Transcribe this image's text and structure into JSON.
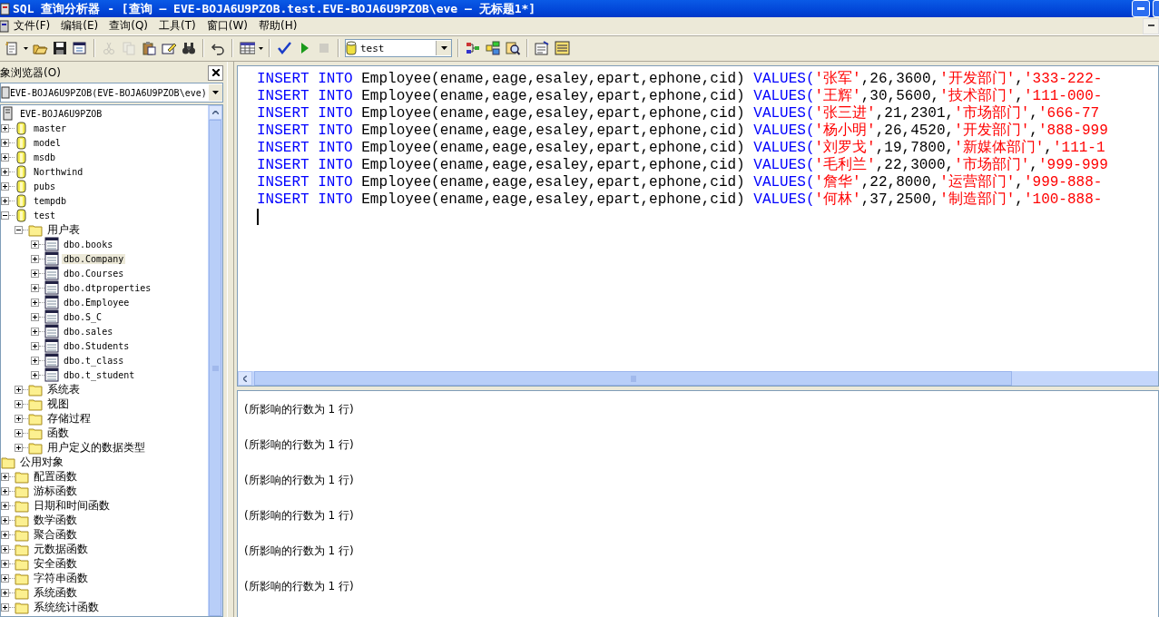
{
  "window": {
    "title": "SQL 查询分析器 - [查询 — EVE-BOJA6U9PZOB.test.EVE-BOJA6U9PZOB\\eve — 无标题1*]"
  },
  "menu": [
    "文件(F)",
    "编辑(E)",
    "查询(Q)",
    "工具(T)",
    "窗口(W)",
    "帮助(H)"
  ],
  "toolbar": [
    {
      "kind": "button",
      "disabled": false
    },
    {
      "kind": "caret"
    },
    {
      "kind": "button",
      "disabled": false
    },
    {
      "kind": "button",
      "disabled": false
    },
    {
      "kind": "button",
      "disabled": false
    },
    {
      "kind": "separator"
    },
    {
      "kind": "button",
      "disabled": true
    },
    {
      "kind": "button",
      "disabled": true
    },
    {
      "kind": "button",
      "disabled": false
    },
    {
      "kind": "button",
      "disabled": false
    },
    {
      "kind": "button",
      "disabled": false
    },
    {
      "kind": "separator"
    },
    {
      "kind": "button",
      "disabled": false
    },
    {
      "kind": "separator"
    },
    {
      "kind": "button",
      "disabled": false
    },
    {
      "kind": "caret"
    },
    {
      "kind": "separator"
    },
    {
      "kind": "button",
      "disabled": false
    },
    {
      "kind": "button",
      "disabled": false
    },
    {
      "kind": "button",
      "disabled": true
    },
    {
      "kind": "separator"
    },
    {
      "kind": "database_select",
      "value": "test"
    },
    {
      "kind": "separator"
    },
    {
      "kind": "button",
      "disabled": false
    },
    {
      "kind": "button",
      "disabled": false
    },
    {
      "kind": "button",
      "disabled": false
    },
    {
      "kind": "separator"
    },
    {
      "kind": "button",
      "disabled": false
    },
    {
      "kind": "button",
      "disabled": false
    }
  ],
  "object_browser": {
    "title": "象浏览器(O)",
    "server_select": "EVE-BOJA6U9PZOB(EVE-BOJA6U9PZOB\\eve)",
    "tree": [
      {
        "label": "EVE-BOJA6U9PZOB",
        "kind": "server",
        "selected": false,
        "children": [
          {
            "label": "master",
            "kind": "database",
            "expanded": false,
            "selected": false
          },
          {
            "label": "model",
            "kind": "database",
            "expanded": false,
            "selected": false
          },
          {
            "label": "msdb",
            "kind": "database",
            "expanded": false,
            "selected": false
          },
          {
            "label": "Northwind",
            "kind": "database",
            "expanded": false,
            "selected": false
          },
          {
            "label": "pubs",
            "kind": "database",
            "expanded": false,
            "selected": false
          },
          {
            "label": "tempdb",
            "kind": "database",
            "expanded": false,
            "selected": false
          },
          {
            "label": "test",
            "kind": "database",
            "expanded": true,
            "selected": false,
            "children": [
              {
                "label": "用户表",
                "kind": "folder",
                "expanded": true,
                "selected": false,
                "children": [
                  {
                    "label": "dbo.books",
                    "kind": "table",
                    "expanded": false,
                    "selected": false
                  },
                  {
                    "label": "dbo.Company",
                    "kind": "table",
                    "expanded": false,
                    "selected": true
                  },
                  {
                    "label": "dbo.Courses",
                    "kind": "table",
                    "expanded": false,
                    "selected": false
                  },
                  {
                    "label": "dbo.dtproperties",
                    "kind": "table",
                    "expanded": false,
                    "selected": false
                  },
                  {
                    "label": "dbo.Employee",
                    "kind": "table",
                    "expanded": false,
                    "selected": false
                  },
                  {
                    "label": "dbo.S_C",
                    "kind": "table",
                    "expanded": false,
                    "selected": false
                  },
                  {
                    "label": "dbo.sales",
                    "kind": "table",
                    "expanded": false,
                    "selected": false
                  },
                  {
                    "label": "dbo.Students",
                    "kind": "table",
                    "expanded": false,
                    "selected": false
                  },
                  {
                    "label": "dbo.t_class",
                    "kind": "table",
                    "expanded": false,
                    "selected": false
                  },
                  {
                    "label": "dbo.t_student",
                    "kind": "table",
                    "expanded": false,
                    "selected": false
                  }
                ]
              },
              {
                "label": "系统表",
                "kind": "folder",
                "expanded": false,
                "selected": false
              },
              {
                "label": "视图",
                "kind": "folder",
                "expanded": false,
                "selected": false
              },
              {
                "label": "存储过程",
                "kind": "folder",
                "expanded": false,
                "selected": false
              },
              {
                "label": "函数",
                "kind": "folder",
                "expanded": false,
                "selected": false
              },
              {
                "label": "用户定义的数据类型",
                "kind": "folder",
                "expanded": false,
                "selected": false
              }
            ]
          }
        ]
      },
      {
        "label": "公用对象",
        "kind": "folder",
        "selected": false,
        "children": [
          {
            "label": "配置函数",
            "kind": "folder",
            "expanded": false,
            "selected": false
          },
          {
            "label": "游标函数",
            "kind": "folder",
            "expanded": false,
            "selected": false
          },
          {
            "label": "日期和时间函数",
            "kind": "folder",
            "expanded": false,
            "selected": false
          },
          {
            "label": "数学函数",
            "kind": "folder",
            "expanded": false,
            "selected": false
          },
          {
            "label": "聚合函数",
            "kind": "folder",
            "expanded": false,
            "selected": false
          },
          {
            "label": "元数据函数",
            "kind": "folder",
            "expanded": false,
            "selected": false
          },
          {
            "label": "安全函数",
            "kind": "folder",
            "expanded": false,
            "selected": false
          },
          {
            "label": "字符串函数",
            "kind": "folder",
            "expanded": false,
            "selected": false
          },
          {
            "label": "系统函数",
            "kind": "folder",
            "expanded": false,
            "selected": false
          },
          {
            "label": "系统统计函数",
            "kind": "folder",
            "expanded": false,
            "selected": false
          }
        ]
      }
    ]
  },
  "editor": {
    "lines": [
      [
        {
          "kind": "keyword",
          "text": "INSERT INTO"
        },
        {
          "kind": "plain",
          "text": " Employee(ename,eage,esaley,epart,ephone,cid) "
        },
        {
          "kind": "keyword",
          "text": "VALUES("
        },
        {
          "kind": "string",
          "text": "'张军'"
        },
        {
          "kind": "plain",
          "text": ",26,3600,"
        },
        {
          "kind": "string",
          "text": "'开发部门'"
        },
        {
          "kind": "plain",
          "text": ","
        },
        {
          "kind": "string",
          "text": "'333-222-"
        }
      ],
      [
        {
          "kind": "keyword",
          "text": "INSERT INTO"
        },
        {
          "kind": "plain",
          "text": " Employee(ename,eage,esaley,epart,ephone,cid) "
        },
        {
          "kind": "keyword",
          "text": "VALUES("
        },
        {
          "kind": "string",
          "text": "'王辉'"
        },
        {
          "kind": "plain",
          "text": ",30,5600,"
        },
        {
          "kind": "string",
          "text": "'技术部门'"
        },
        {
          "kind": "plain",
          "text": ","
        },
        {
          "kind": "string",
          "text": "'111-000-"
        }
      ],
      [
        {
          "kind": "keyword",
          "text": "INSERT INTO"
        },
        {
          "kind": "plain",
          "text": " Employee(ename,eage,esaley,epart,ephone,cid) "
        },
        {
          "kind": "keyword",
          "text": "VALUES("
        },
        {
          "kind": "string",
          "text": "'张三进'"
        },
        {
          "kind": "plain",
          "text": ",21,2301,"
        },
        {
          "kind": "string",
          "text": "'市场部门'"
        },
        {
          "kind": "plain",
          "text": ","
        },
        {
          "kind": "string",
          "text": "'666-77"
        }
      ],
      [
        {
          "kind": "keyword",
          "text": "INSERT INTO"
        },
        {
          "kind": "plain",
          "text": " Employee(ename,eage,esaley,epart,ephone,cid) "
        },
        {
          "kind": "keyword",
          "text": "VALUES("
        },
        {
          "kind": "string",
          "text": "'杨小明'"
        },
        {
          "kind": "plain",
          "text": ",26,4520,"
        },
        {
          "kind": "string",
          "text": "'开发部门'"
        },
        {
          "kind": "plain",
          "text": ","
        },
        {
          "kind": "string",
          "text": "'888-999"
        }
      ],
      [
        {
          "kind": "keyword",
          "text": "INSERT INTO"
        },
        {
          "kind": "plain",
          "text": " Employee(ename,eage,esaley,epart,ephone,cid) "
        },
        {
          "kind": "keyword",
          "text": "VALUES("
        },
        {
          "kind": "string",
          "text": "'刘罗戈'"
        },
        {
          "kind": "plain",
          "text": ",19,7800,"
        },
        {
          "kind": "string",
          "text": "'新媒体部门'"
        },
        {
          "kind": "plain",
          "text": ","
        },
        {
          "kind": "string",
          "text": "'111-1"
        }
      ],
      [
        {
          "kind": "keyword",
          "text": "INSERT INTO"
        },
        {
          "kind": "plain",
          "text": " Employee(ename,eage,esaley,epart,ephone,cid) "
        },
        {
          "kind": "keyword",
          "text": "VALUES("
        },
        {
          "kind": "string",
          "text": "'毛利兰'"
        },
        {
          "kind": "plain",
          "text": ",22,3000,"
        },
        {
          "kind": "string",
          "text": "'市场部门'"
        },
        {
          "kind": "plain",
          "text": ","
        },
        {
          "kind": "string",
          "text": "'999-999"
        }
      ],
      [
        {
          "kind": "keyword",
          "text": "INSERT INTO"
        },
        {
          "kind": "plain",
          "text": " Employee(ename,eage,esaley,epart,ephone,cid) "
        },
        {
          "kind": "keyword",
          "text": "VALUES("
        },
        {
          "kind": "string",
          "text": "'詹华'"
        },
        {
          "kind": "plain",
          "text": ",22,8000,"
        },
        {
          "kind": "string",
          "text": "'运营部门'"
        },
        {
          "kind": "plain",
          "text": ","
        },
        {
          "kind": "string",
          "text": "'999-888-"
        }
      ],
      [
        {
          "kind": "keyword",
          "text": "INSERT INTO"
        },
        {
          "kind": "plain",
          "text": " Employee(ename,eage,esaley,epart,ephone,cid) "
        },
        {
          "kind": "keyword",
          "text": "VALUES("
        },
        {
          "kind": "string",
          "text": "'何林'"
        },
        {
          "kind": "plain",
          "text": ",37,2500,"
        },
        {
          "kind": "string",
          "text": "'制造部门'"
        },
        {
          "kind": "plain",
          "text": ","
        },
        {
          "kind": "string",
          "text": "'100-888-"
        }
      ]
    ]
  },
  "results": [
    "(所影响的行数为 1 行)",
    "(所影响的行数为 1 行)",
    "(所影响的行数为 1 行)",
    "(所影响的行数为 1 行)",
    "(所影响的行数为 1 行)",
    "(所影响的行数为 1 行)"
  ]
}
